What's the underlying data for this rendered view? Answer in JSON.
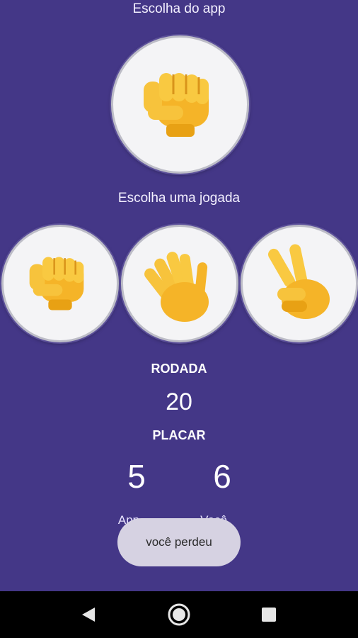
{
  "screen": {
    "app_choice_label": "Escolha do app",
    "user_choice_label": "Escolha uma jogada"
  },
  "app_choice": {
    "icon": "rock-fist-icon"
  },
  "options": [
    {
      "icon": "rock-fist-icon"
    },
    {
      "icon": "paper-hand-icon"
    },
    {
      "icon": "scissors-victory-icon"
    }
  ],
  "round": {
    "title": "RODADA",
    "value": "20"
  },
  "scoreboard": {
    "title": "PLACAR",
    "app_score": "5",
    "user_score": "6",
    "app_label": "App",
    "user_label": "Você"
  },
  "toast": {
    "message": "você perdeu"
  },
  "navbar": {
    "back_icon": "back-icon",
    "home_icon": "home-icon",
    "recent_icon": "recent-apps-icon"
  },
  "colors": {
    "background": "#443787",
    "circle": "#f4f4f6",
    "emoji": "#f7b92b",
    "toast": "#d6d2e2"
  }
}
